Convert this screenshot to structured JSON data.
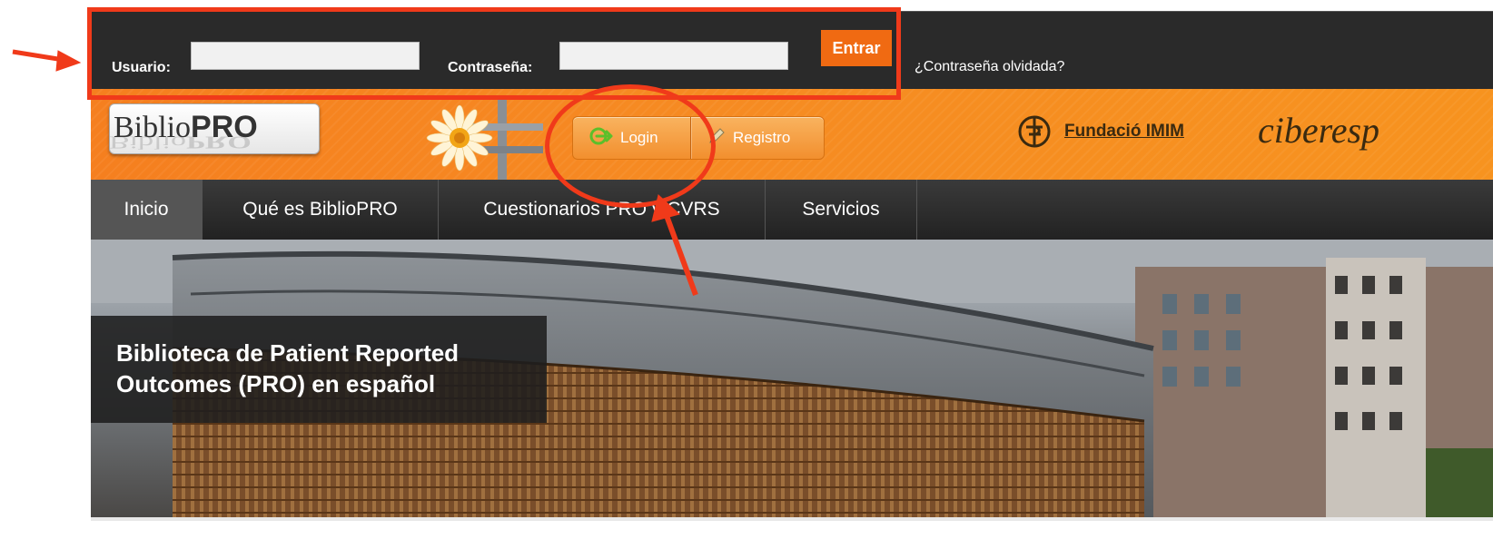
{
  "login_bar": {
    "user_label": "Usuario:",
    "user_value": "",
    "password_label": "Contraseña:",
    "password_value": "",
    "submit_label": "Entrar",
    "forgot_link": "¿Contraseña olvidada?"
  },
  "header": {
    "logo_prefix": "Biblio",
    "logo_suffix": "PRO",
    "login_button": "Login",
    "register_button": "Registro",
    "partner_1": "Fundació IMIM",
    "partner_2": "ciberesp"
  },
  "nav": {
    "items": [
      {
        "label": "Inicio",
        "active": true
      },
      {
        "label": "Qué es BiblioPRO",
        "active": false
      },
      {
        "label": "Cuestionarios PRO y CVRS",
        "active": false
      },
      {
        "label": "Servicios",
        "active": false
      }
    ]
  },
  "hero": {
    "caption_line1": "Biblioteca de Patient Reported",
    "caption_line2": "Outcomes (PRO) en español"
  },
  "colors": {
    "accent_orange": "#f57f1f",
    "dark_bar": "#2a2a2a",
    "annotation_red": "#f03a1a"
  }
}
